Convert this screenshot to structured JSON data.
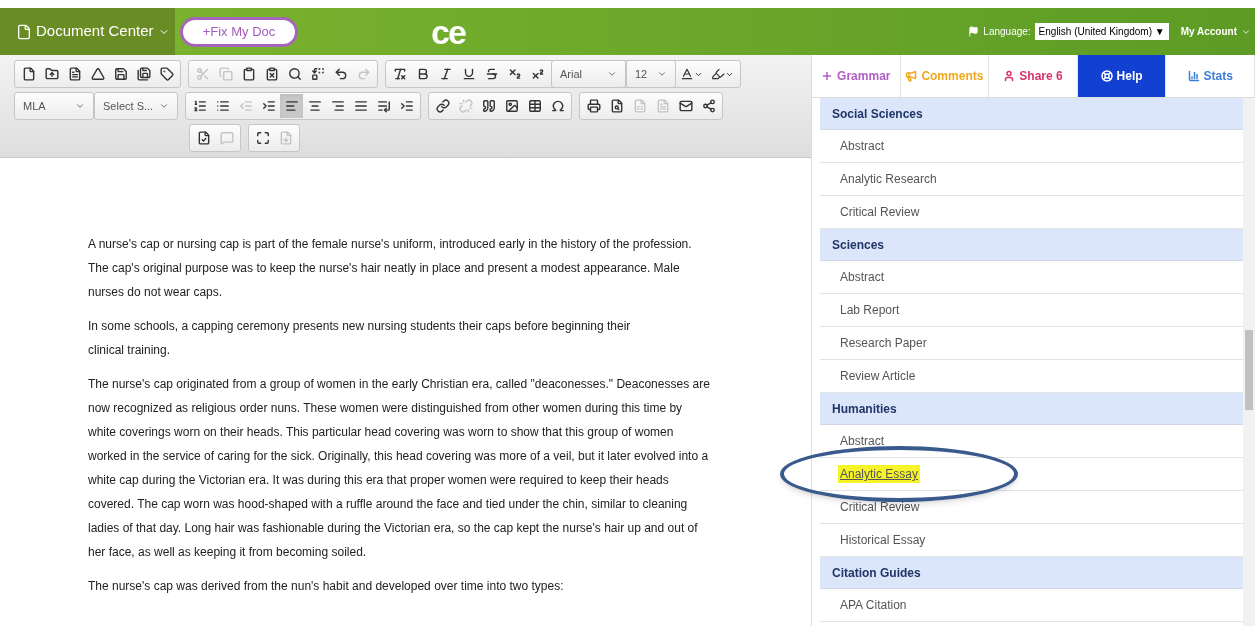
{
  "header": {
    "menu": "Document Center",
    "fix_button": "+Fix My Doc",
    "logo": "ce",
    "language_label": "Language:",
    "language_value": "English (United Kingdom) ▼",
    "account": "My Account"
  },
  "toolbar": {
    "row1": [
      [
        {
          "disabled": false
        },
        {
          "disabled": false
        },
        {
          "disabled": false
        },
        {
          "disabled": false
        },
        {
          "disabled": false
        },
        {
          "disabled": false
        },
        {
          "disabled": false
        }
      ],
      [
        {
          "disabled": true
        },
        {
          "disabled": true
        },
        {
          "disabled": false
        },
        {
          "disabled": false
        },
        {
          "disabled": false
        },
        {
          "disabled": false
        },
        {
          "disabled": false
        },
        {
          "disabled": true
        }
      ],
      [
        {
          "disabled": false
        },
        {
          "disabled": false
        },
        {
          "disabled": false
        },
        {
          "disabled": false
        },
        {
          "disabled": false
        },
        {
          "disabled": false
        },
        {
          "disabled": false
        }
      ]
    ],
    "font": "Arial",
    "size": "12",
    "style_selects": [
      "MLA",
      "Select S..."
    ],
    "row2": [
      [
        {
          "active": false,
          "disabled": false
        },
        {
          "active": false,
          "disabled": false
        },
        {
          "active": false,
          "disabled": true
        },
        {
          "active": false,
          "disabled": false
        },
        {
          "active": true,
          "disabled": false
        },
        {
          "active": false,
          "disabled": false
        },
        {
          "active": false,
          "disabled": false
        },
        {
          "active": false,
          "disabled": false
        },
        {
          "active": false,
          "disabled": false
        },
        {
          "active": false,
          "disabled": false
        }
      ],
      [
        {
          "active": false,
          "disabled": false
        },
        {
          "active": false,
          "disabled": true
        },
        {
          "active": false,
          "disabled": false
        },
        {
          "active": false,
          "disabled": false
        },
        {
          "active": false,
          "disabled": false
        },
        {
          "active": false,
          "disabled": false
        }
      ],
      [
        {
          "active": false,
          "disabled": false
        },
        {
          "active": false,
          "disabled": false
        },
        {
          "active": false,
          "disabled": true
        },
        {
          "active": false,
          "disabled": true
        },
        {
          "active": false,
          "disabled": false
        },
        {
          "active": false,
          "disabled": false
        }
      ]
    ],
    "row3": [
      [
        {
          "disabled": false
        },
        {
          "disabled": true
        }
      ],
      [
        {
          "disabled": false
        },
        {
          "disabled": true
        }
      ]
    ]
  },
  "document": {
    "paragraphs": [
      [
        "A nurse's cap or nursing cap is part of the female nurse's uniform, introduced early in the history of the profession.",
        "The cap's original purpose was to keep the nurse's hair neatly in place and present a modest appearance. Male",
        "nurses do not wear caps."
      ],
      [
        "In some schools, a capping ceremony presents new nursing students their caps before beginning their",
        "clinical training."
      ],
      [
        "The nurse's cap originated from a group of women in the early Christian era, called \"deaconesses.\" Deaconesses are",
        "now recognized as religious order nuns. These women were distinguished from other women during this time by",
        "white coverings worn on their heads. This particular head covering was worn to show that this group of women",
        "worked in the service of caring for the sick. Originally, this head covering was more of a veil, but it later evolved into a",
        "white cap during the Victorian era. It was during this era that proper women were required to keep their heads",
        "covered. The cap worn was hood-shaped with a ruffle around the face and tied under the chin, similar to cleaning",
        "ladies of that day. Long hair was fashionable during the Victorian era, so the cap kept the nurse's hair up and out of",
        "her face, as well as keeping it from becoming soiled."
      ],
      [
        "The nurse's cap was derived from the nun's habit and developed over time into two types:"
      ]
    ]
  },
  "panel": {
    "tabs": [
      {
        "label": "Grammar",
        "color": "#b35cc4",
        "selected": false
      },
      {
        "label": "Comments",
        "color": "#f0a81c",
        "selected": false
      },
      {
        "label": "Share 6",
        "color": "#d8336a",
        "selected": false
      },
      {
        "label": "Help",
        "color": "#1240d0",
        "selected": true
      },
      {
        "label": "Stats",
        "color": "#3b7fd9",
        "selected": false
      }
    ],
    "sections": [
      {
        "heading": "Social Sciences",
        "items": [
          {
            "label": "Abstract",
            "highlighted": false,
            "circled": false
          },
          {
            "label": "Analytic Research",
            "highlighted": false,
            "circled": false
          },
          {
            "label": "Critical Review",
            "highlighted": false,
            "circled": false
          }
        ]
      },
      {
        "heading": "Sciences",
        "items": [
          {
            "label": "Abstract",
            "highlighted": false,
            "circled": false
          },
          {
            "label": "Lab Report",
            "highlighted": false,
            "circled": false
          },
          {
            "label": "Research Paper",
            "highlighted": false,
            "circled": false
          },
          {
            "label": "Review Article",
            "highlighted": false,
            "circled": false
          }
        ]
      },
      {
        "heading": "Humanities",
        "items": [
          {
            "label": "Abstract",
            "highlighted": false,
            "circled": false
          },
          {
            "label": "Analytic Essay",
            "highlighted": true,
            "circled": true
          },
          {
            "label": "Critical Review",
            "highlighted": false,
            "circled": false
          },
          {
            "label": "Historical Essay",
            "highlighted": false,
            "circled": false
          }
        ]
      },
      {
        "heading": "Citation Guides",
        "items": [
          {
            "label": "APA Citation",
            "highlighted": false,
            "circled": false
          }
        ]
      }
    ]
  }
}
